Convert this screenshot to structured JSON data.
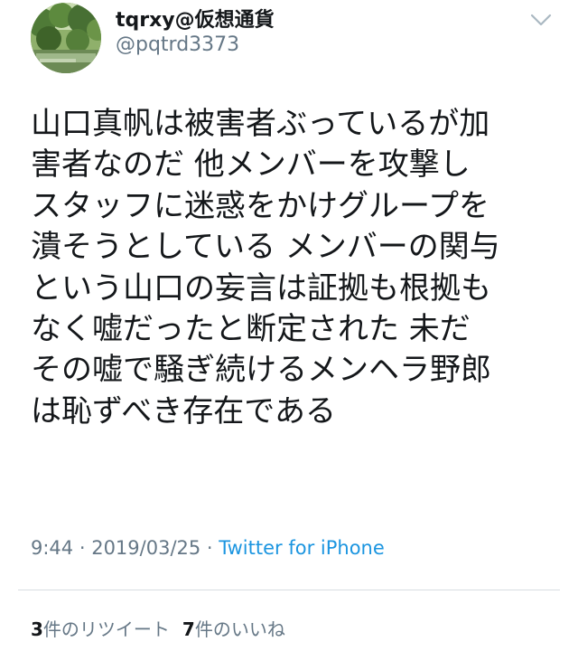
{
  "user": {
    "display_name": "tqrxy@仮想通貨",
    "screen_name": "@pqtrd3373",
    "avatar_icon": "avatar-photo-trees"
  },
  "header": {
    "more_icon": "chevron-down-icon"
  },
  "tweet": {
    "text": "山口真帆は被害者ぶっているが加\n害者なのだ 他メンバーを攻撃し\nスタッフに迷惑をかけグループを\n潰そうとしている メンバーの関与\nという山口の妄言は証拠も根拠も\nなく嘘だったと断定された 未だ\nその嘘で騒ぎ続けるメンヘラ野郎\nは恥ずべき存在である",
    "time": "9:44",
    "date": "2019/03/25",
    "separator": " · ",
    "source": "Twitter for iPhone"
  },
  "stats": {
    "retweets_count": "3",
    "retweets_label": "件のリツイート",
    "likes_count": "7",
    "likes_label": "件のいいね"
  },
  "colors": {
    "text": "#14171a",
    "secondary": "#657786",
    "link": "#1b95e0",
    "divider": "#d8dde1"
  }
}
